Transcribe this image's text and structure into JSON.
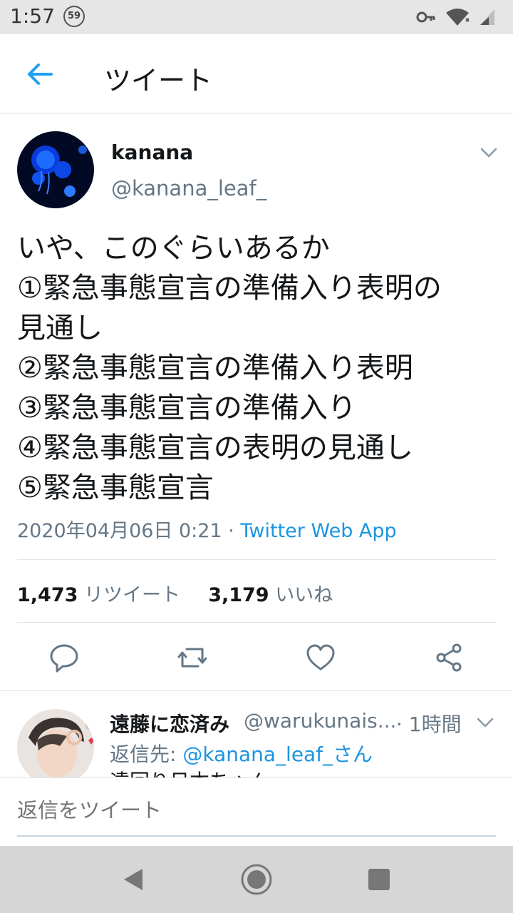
{
  "status_bar": {
    "time": "1:57",
    "notification_count": "59"
  },
  "header": {
    "title": "ツイート"
  },
  "tweet": {
    "display_name": "kanana",
    "handle": "@kanana_leaf_",
    "lines": [
      "いや、このぐらいあるか",
      "①緊急事態宣言の準備入り表明の",
      "見通し",
      "②緊急事態宣言の準備入り表明",
      "③緊急事態宣言の準備入り",
      "④緊急事態宣言の表明の見通し",
      "⑤緊急事態宣言"
    ],
    "timestamp": "2020年04月06日 0:21",
    "separator": " · ",
    "source": "Twitter Web App",
    "retweet_count": "1,473",
    "retweet_label": "リツイート",
    "like_count": "3,179",
    "like_label": "いいね"
  },
  "reply": {
    "display_name": "遠藤に恋済み",
    "handle": "@warukunais...",
    "time": "· 1時間",
    "reply_to_prefix": "返信先: ",
    "reply_to_mention": "@kanana_leaf_さん",
    "preview": "遠回り日本ちゃん"
  },
  "compose": {
    "placeholder": "返信をツイート"
  },
  "colors": {
    "accent": "#1da1f2",
    "link": "#1b95e0",
    "text": "#14171a",
    "secondary": "#657786"
  },
  "icons": [
    "back-arrow-icon",
    "chevron-down-icon",
    "reply-icon",
    "retweet-icon",
    "like-icon",
    "share-icon",
    "key-icon",
    "wifi-icon",
    "signal-icon",
    "nav-back-icon",
    "nav-home-icon",
    "nav-recents-icon"
  ]
}
